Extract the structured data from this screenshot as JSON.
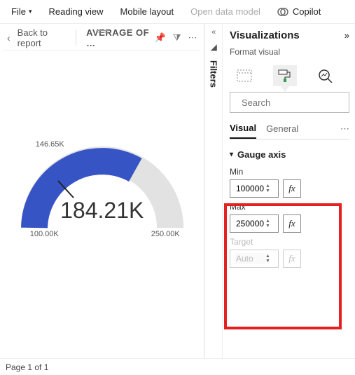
{
  "toolbar": {
    "file": "File",
    "reading_view": "Reading view",
    "mobile_layout": "Mobile layout",
    "open_model": "Open data model",
    "copilot": "Copilot"
  },
  "canvas": {
    "back_label": "Back to report",
    "visual_title": "AVERAGE OF …"
  },
  "gauge": {
    "value_label": "184.21K",
    "needle_label": "146.65K",
    "min_label": "100.00K",
    "max_label": "250.00K"
  },
  "chart_data": {
    "type": "gauge",
    "title": "AVERAGE OF …",
    "min": 100000,
    "max": 250000,
    "value": 184210,
    "needle_marker": 146650,
    "display": {
      "min_label": "100.00K",
      "max_label": "250.00K",
      "value_label": "184.21K",
      "needle_label": "146.65K"
    },
    "fill_color": "#3754c4",
    "track_color": "#e2e2e2"
  },
  "filters": {
    "title": "Filters"
  },
  "viz": {
    "title": "Visualizations",
    "subtitle": "Format visual",
    "search_placeholder": "Search",
    "tab_visual": "Visual",
    "tab_general": "General"
  },
  "gauge_axis": {
    "section_title": "Gauge axis",
    "min_label": "Min",
    "min_value": "100000",
    "max_label": "Max",
    "max_value": "250000",
    "target_label": "Target",
    "target_value": "Auto",
    "fx_label": "fx"
  },
  "status": {
    "page": "Page 1 of 1"
  }
}
